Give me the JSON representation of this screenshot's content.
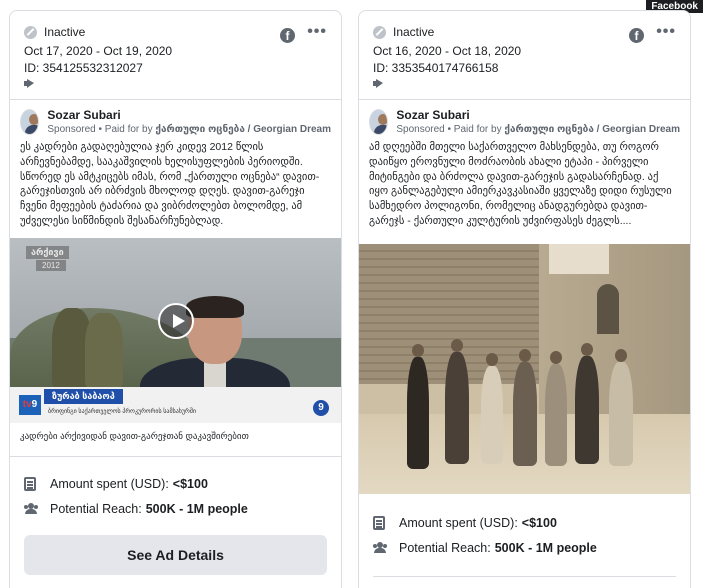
{
  "watermark": "Facebook",
  "cards": [
    {
      "status": "Inactive",
      "dates": "Oct 17, 2020 - Oct 19, 2020",
      "id": "ID: 354125532312027",
      "advertiser": "Sozar Subari",
      "sponsored": "Sponsored",
      "paid_by_prefix": " • Paid for by ",
      "paid_by": "ქართული ოცნება / Georgian Dream",
      "text": "ეს კადრები გადაღებულია ჯერ კიდევ 2012 წლის არჩევნებამდე, სააკაშვილის ხელისუფლების პერიოდში. სწორედ ეს ამტკიცებს იმას, რომ „ქართული ოცნება“ დავით-გარეჯისთვის არ იბრძვის მხოლოდ დღეს. დავით-გარეჯი ჩვენი მეფეების ტაძარია და ვიბრძოლებთ ბოლომდე, ამ უძველესი სიწმინდის შესანარჩუნებლად.",
      "video_watermark": "არქივი",
      "video_year": "2012",
      "lower_third_name": "ზურაბ საბაოპ",
      "lower_third_sub": "ბრიფინგი საქართველოს პროკურორის სამსახურში",
      "caption": "კადრები არქივიდან დავით-გარეჯთან დაკავშირებით",
      "amount_label": "Amount spent (USD):",
      "amount_value": "<$100",
      "reach_label": "Potential Reach:",
      "reach_value": "500K - 1M people",
      "button": "See Ad Details"
    },
    {
      "status": "Inactive",
      "dates": "Oct 16, 2020 - Oct 18, 2020",
      "id": "ID: 3353540174766158",
      "advertiser": "Sozar Subari",
      "sponsored": "Sponsored",
      "paid_by_prefix": " • Paid for by ",
      "paid_by": "ქართული ოცნება / Georgian Dream",
      "text": "ამ დღეებში მთელი საქართველო მახსენდება, თუ როგორ დაიწყო ეროვნული მოძრაობის ახალი ეტაპი - პირველი მიტინგები და ბრძოლა დავით-გარეჯის გადასარჩენად. აქ იყო განლაგებული ამიერკავკასიაში ყველაზე დიდი რუსული სამხედრო პოლიგონი, რომელიც ანადგურებდა დავით-გარეჯს - ქართული კულტურის უძვირფასეს ძეგლს....",
      "amount_label": "Amount spent (USD):",
      "amount_value": "<$100",
      "reach_label": "Potential Reach:",
      "reach_value": "500K - 1M people"
    }
  ]
}
